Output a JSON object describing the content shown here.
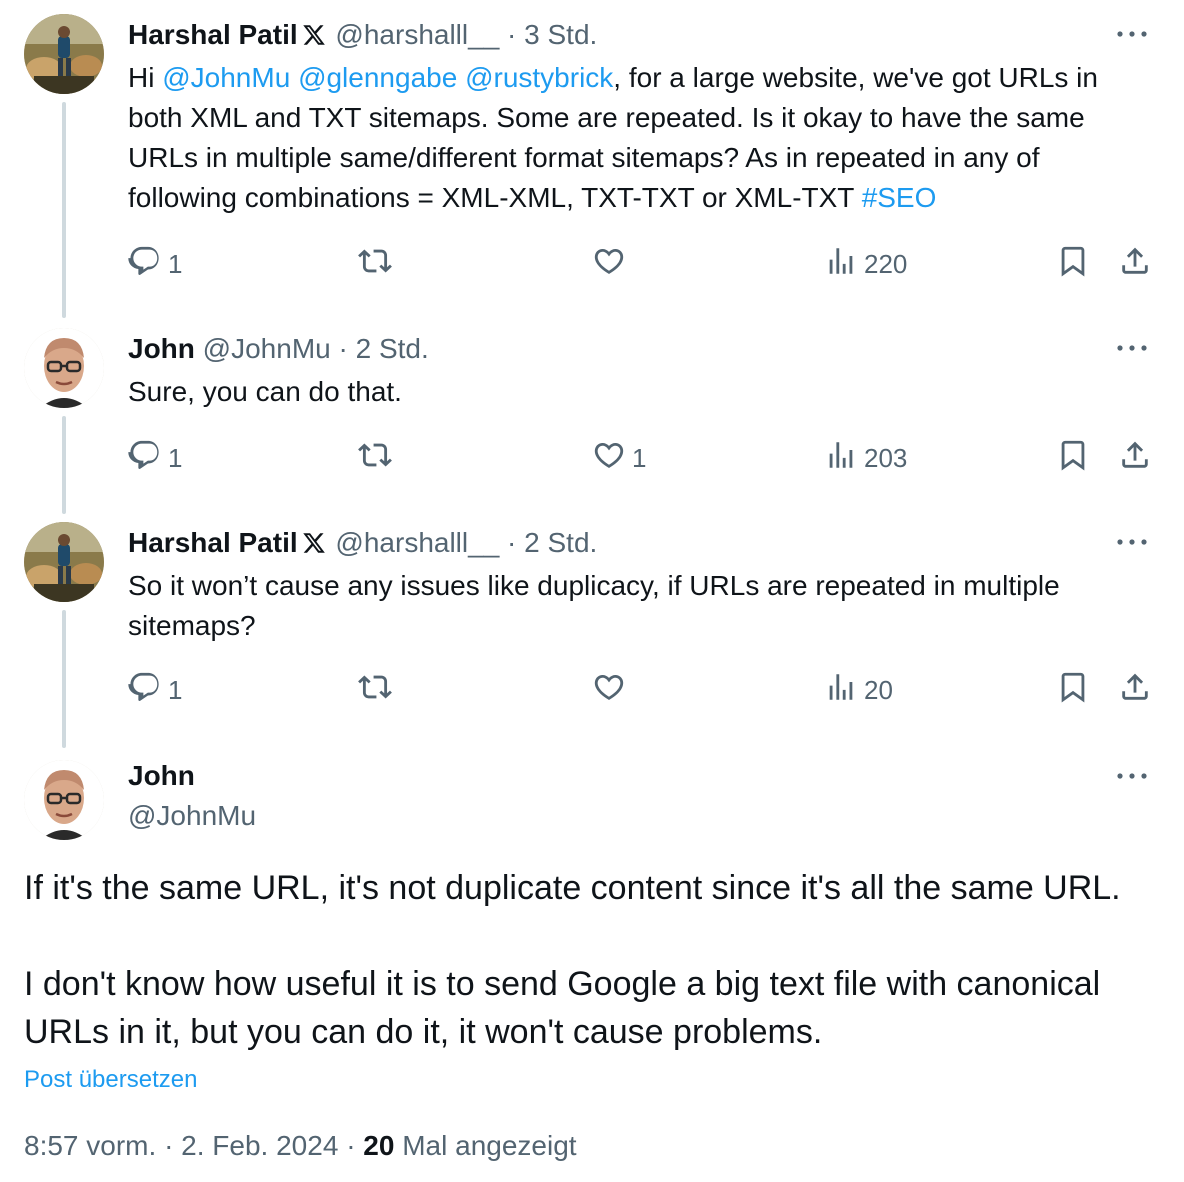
{
  "tweets": [
    {
      "name": "Harshal Patil",
      "verified_icon": "x-logo-icon",
      "handle": "@harshalll__",
      "separator": "·",
      "time": "3 Std.",
      "text_segments": [
        {
          "t": "Hi ",
          "kind": "text"
        },
        {
          "t": "@JohnMu",
          "kind": "mention"
        },
        {
          "t": " ",
          "kind": "text"
        },
        {
          "t": "@glenngabe",
          "kind": "mention"
        },
        {
          "t": " ",
          "kind": "text"
        },
        {
          "t": "@rustybrick",
          "kind": "mention"
        },
        {
          "t": ", for a large website, we've got URLs in both XML and TXT sitemaps. Some are repeated. Is it okay to have the same URLs in multiple same/different format sitemaps? As in repeated in any of following combinations = XML-XML, TXT-TXT or XML-TXT ",
          "kind": "text"
        },
        {
          "t": "#SEO",
          "kind": "hashtag"
        }
      ],
      "replies": "1",
      "reposts": "",
      "likes": "",
      "views": "220"
    },
    {
      "name": "John",
      "handle": "@JohnMu",
      "separator": "·",
      "time": "2 Std.",
      "text": "Sure, you can do that.",
      "replies": "1",
      "reposts": "",
      "likes": "1",
      "views": "203"
    },
    {
      "name": "Harshal Patil",
      "verified_icon": "x-logo-icon",
      "handle": "@harshalll__",
      "separator": "·",
      "time": "2 Std.",
      "text": "So it won’t cause any issues like duplicacy, if URLs are repeated in multiple sitemaps?",
      "replies": "1",
      "reposts": "",
      "likes": "",
      "views": "20"
    }
  ],
  "main_tweet": {
    "name": "John",
    "handle": "@JohnMu",
    "paragraph_1": "If it's the same URL, it's not duplicate content since it's all the same URL.",
    "paragraph_2": "I don't know how useful it is to send Google a big text file with canonical URLs in it, but you can do it, it won't cause problems.",
    "translate_label": "Post übersetzen",
    "time": "8:57 vorm.",
    "separator": "·",
    "date": "2. Feb. 2024",
    "views_count": "20",
    "views_label": "Mal angezeigt"
  },
  "colors": {
    "link": "#1d9bf0",
    "secondary_text": "#536471",
    "primary_text": "#0f1419",
    "thread_line": "#cfd9de"
  },
  "icons": [
    "reply-icon",
    "repost-icon",
    "like-icon",
    "views-icon",
    "bookmark-icon",
    "share-icon",
    "more-icon",
    "x-logo-icon"
  ]
}
